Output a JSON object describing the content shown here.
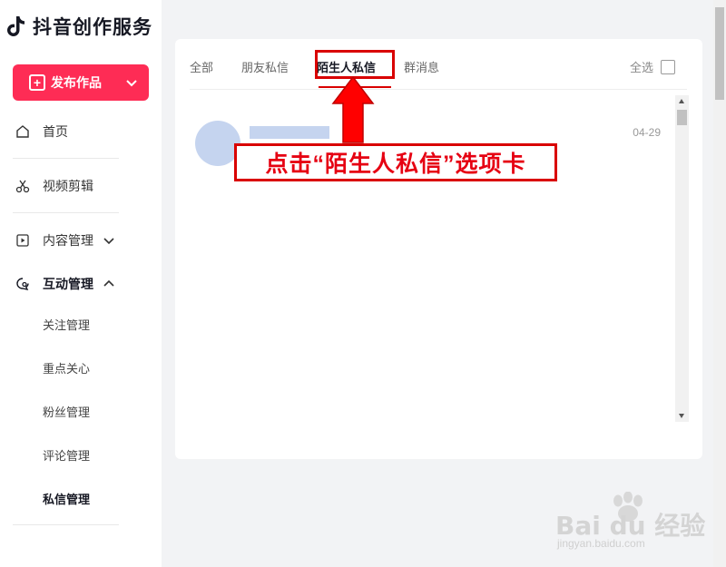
{
  "app": {
    "title": "抖音创作服务"
  },
  "sidebar": {
    "publish_label": "发布作品",
    "items": [
      {
        "label": "首页"
      },
      {
        "label": "视频剪辑"
      },
      {
        "label": "内容管理"
      },
      {
        "label": "互动管理"
      }
    ],
    "sub_items": [
      {
        "label": "关注管理"
      },
      {
        "label": "重点关心"
      },
      {
        "label": "粉丝管理"
      },
      {
        "label": "评论管理"
      },
      {
        "label": "私信管理"
      }
    ]
  },
  "main": {
    "tabs": [
      {
        "label": "全部"
      },
      {
        "label": "朋友私信"
      },
      {
        "label": "陌生人私信",
        "active": true
      },
      {
        "label": "群消息"
      }
    ],
    "select_all_label": "全选",
    "messages": [
      {
        "date": "04-29"
      }
    ]
  },
  "annotation": {
    "text": "点击“陌生人私信”选项卡"
  },
  "watermark": {
    "brand": "Bai du 经验",
    "url": "jingyan.baidu.com"
  },
  "colors": {
    "accent": "#fe2c55",
    "annotation_red": "#d90000",
    "placeholder_blue": "#c5d4ef"
  }
}
